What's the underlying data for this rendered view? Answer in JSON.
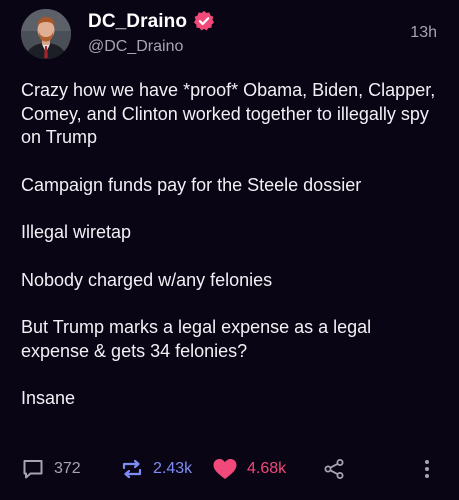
{
  "post": {
    "display_name": "DC_Draino",
    "handle": "@DC_Draino",
    "timestamp": "13h",
    "paragraphs": [
      "Crazy how we have *proof* Obama, Biden, Clapper, Comey, and Clinton worked together to illegally spy on Trump",
      "Campaign funds pay for the Steele dossier",
      "Illegal wiretap",
      "Nobody charged w/any felonies",
      "But Trump marks a legal expense as a legal expense & gets 34 felonies?",
      "Insane"
    ]
  },
  "actions": {
    "reply_count": "372",
    "repost_count": "2.43k",
    "like_count": "4.68k"
  },
  "icons": {
    "verified": "verified-badge-icon",
    "reply": "speech-bubble-icon",
    "repost": "repost-arrows-icon",
    "like": "heart-icon",
    "share": "share-icon",
    "more": "vertical-ellipsis-icon"
  },
  "colors": {
    "background": "#0a0515",
    "text": "#f2f0f5",
    "muted": "#a7a3b0",
    "repost_active": "#7e8cf5",
    "like_active": "#f0497a",
    "verified_badge": "#f0497a"
  }
}
